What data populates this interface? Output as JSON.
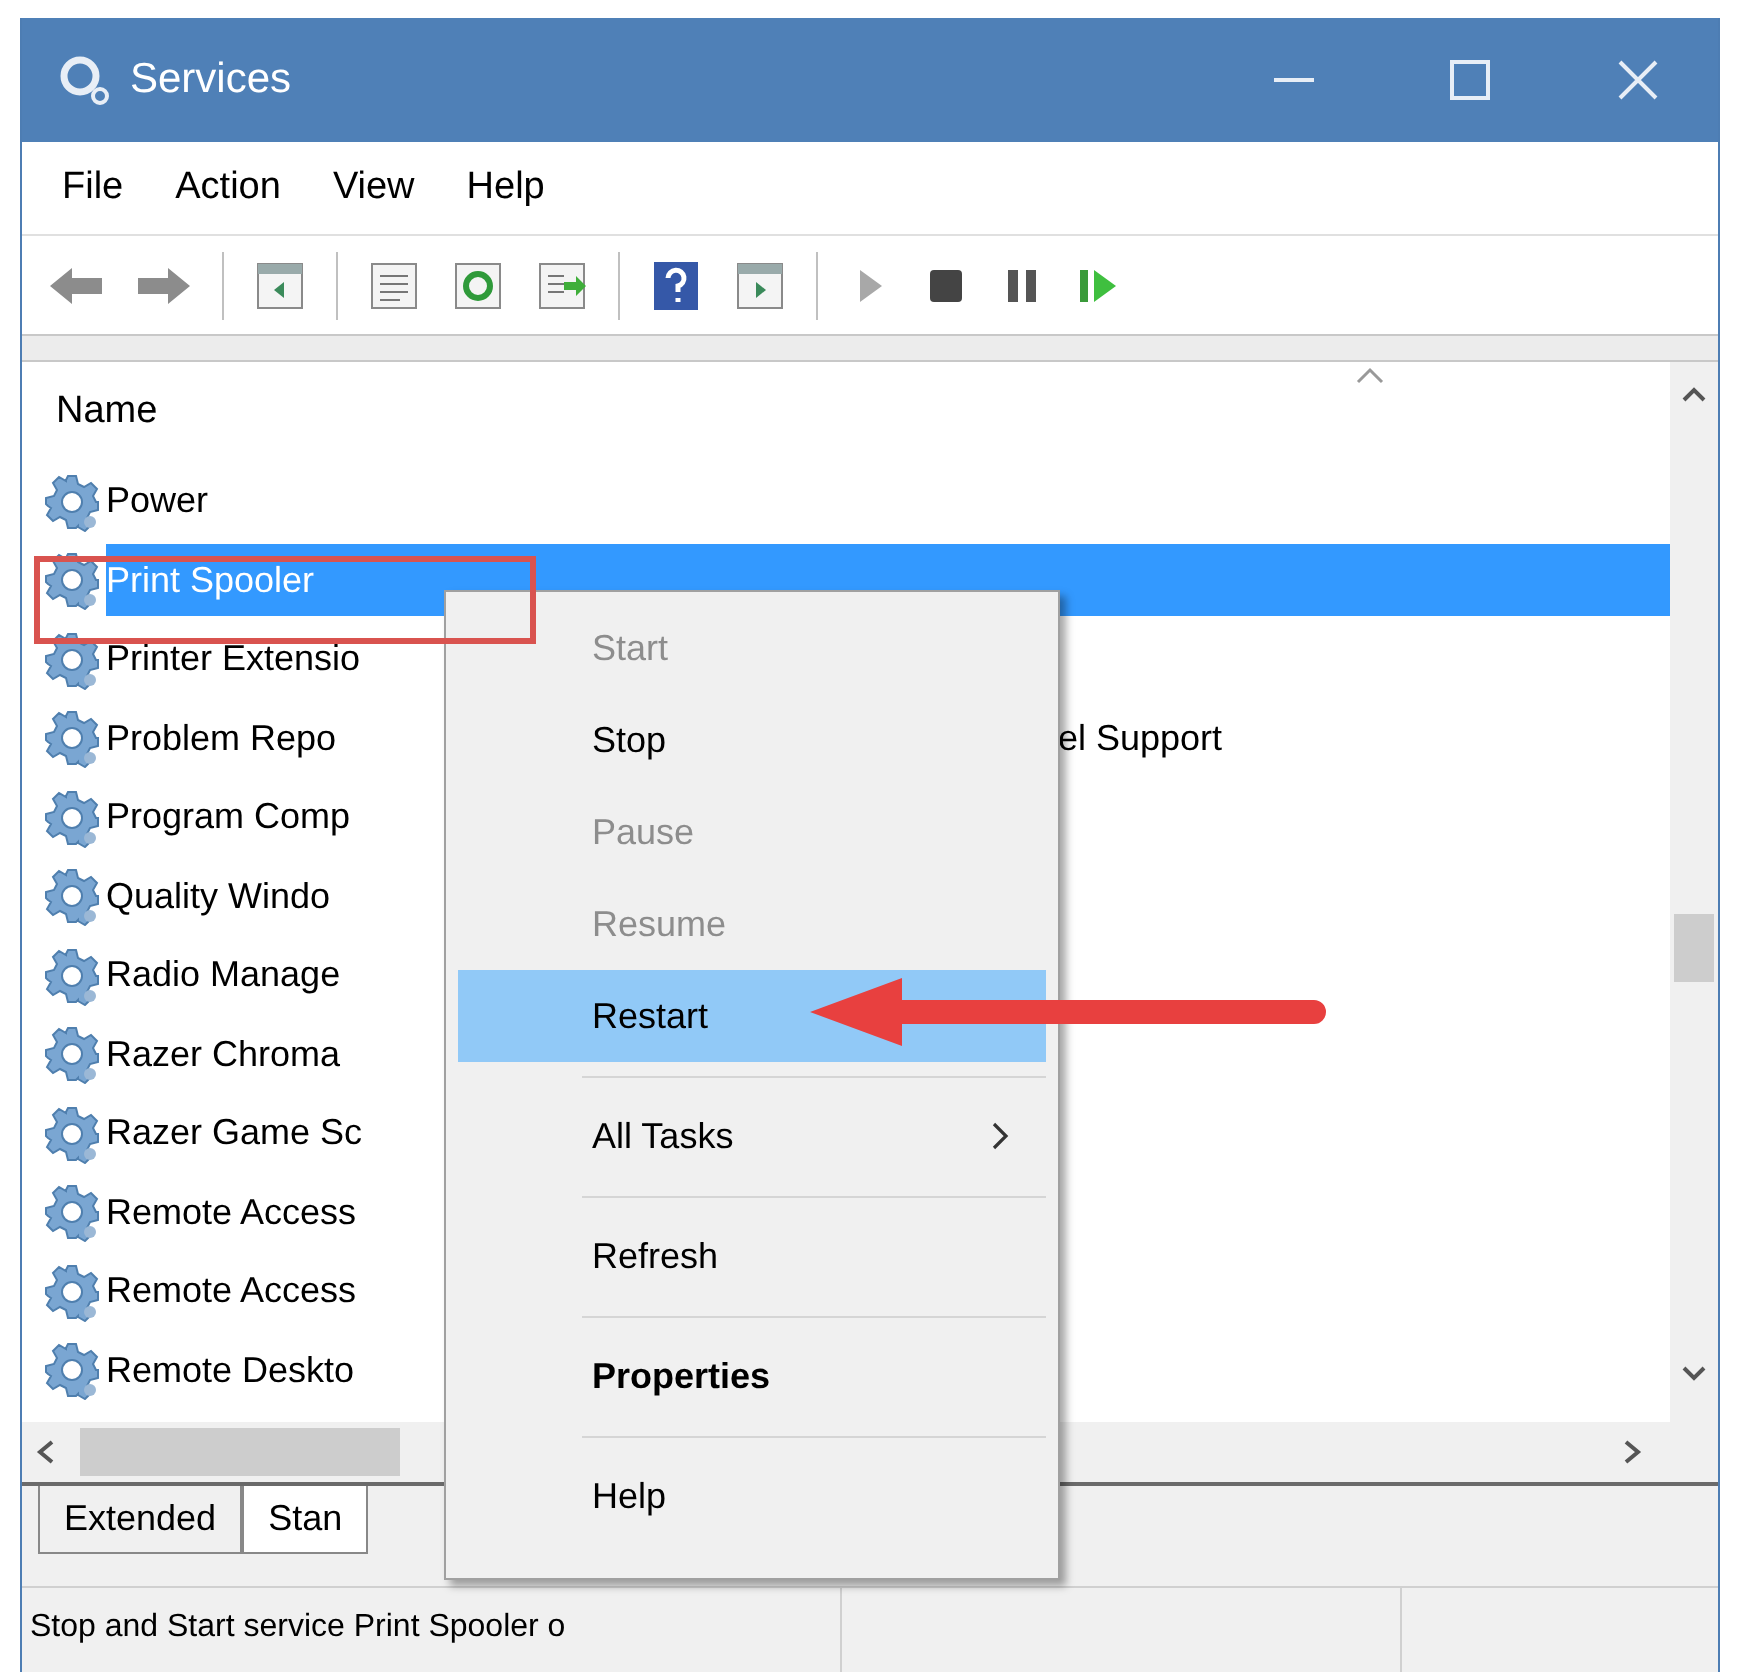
{
  "window": {
    "title": "Services"
  },
  "menu_bar": [
    "File",
    "Action",
    "View",
    "Help"
  ],
  "list": {
    "column": {
      "label": "Name",
      "sort_ascending": true
    },
    "rows": [
      {
        "name": "Power",
        "selected": false
      },
      {
        "name": "Print Spooler",
        "selected": true
      },
      {
        "name": "Printer Extensio",
        "selected": false
      },
      {
        "name": "Problem Repo",
        "selected": false,
        "name_tail": "el Support"
      },
      {
        "name": "Program Comp",
        "selected": false
      },
      {
        "name": "Quality Windo",
        "selected": false
      },
      {
        "name": "Radio Manage",
        "selected": false
      },
      {
        "name": "Razer Chroma",
        "selected": false
      },
      {
        "name": "Razer Game Sc",
        "selected": false
      },
      {
        "name": "Remote Access",
        "selected": false
      },
      {
        "name": "Remote Access",
        "selected": false
      },
      {
        "name": "Remote Deskto",
        "selected": false
      }
    ]
  },
  "context_menu": [
    {
      "kind": "item",
      "label": "Start",
      "disabled": true,
      "selected": false
    },
    {
      "kind": "item",
      "label": "Stop",
      "disabled": false,
      "selected": false
    },
    {
      "kind": "item",
      "label": "Pause",
      "disabled": true,
      "selected": false
    },
    {
      "kind": "item",
      "label": "Resume",
      "disabled": true,
      "selected": false
    },
    {
      "kind": "item",
      "label": "Restart",
      "disabled": false,
      "selected": true
    },
    {
      "kind": "separator"
    },
    {
      "kind": "submenu",
      "label": "All Tasks",
      "disabled": false,
      "selected": false
    },
    {
      "kind": "separator"
    },
    {
      "kind": "item",
      "label": "Refresh",
      "disabled": false,
      "selected": false
    },
    {
      "kind": "separator"
    },
    {
      "kind": "default",
      "label": "Properties",
      "disabled": false,
      "selected": false
    },
    {
      "kind": "separator"
    },
    {
      "kind": "item",
      "label": "Help",
      "disabled": false,
      "selected": false
    }
  ],
  "tabs": [
    {
      "label": "Extended",
      "selected": false
    },
    {
      "label": "Stan",
      "selected": true
    }
  ],
  "status_bar": {
    "text": "Stop and Start service Print Spooler o"
  }
}
